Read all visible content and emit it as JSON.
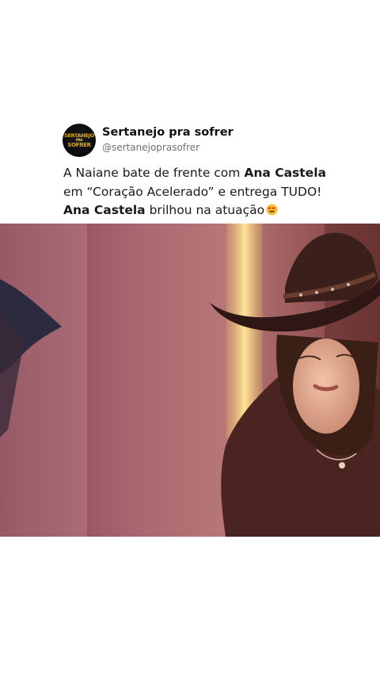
{
  "account": {
    "display_name": "Sertanejo pra sofrer",
    "handle": "@sertanejoprasofrer",
    "avatar_logo": {
      "line1": "SERTANEJO",
      "line2": "PRA",
      "line3": "SOFRER"
    }
  },
  "caption": {
    "line1_prefix": "A Naiane bate de frente com ",
    "line1_bold": "Ana Castela",
    "line2": "em “Coração Acelerado” e entrega TUDO!",
    "line3_bold": "Ana Castela",
    "line3_rest": " brilhou na atuação",
    "emoji": "heart-eyes-emoji-icon"
  },
  "video": {
    "description_icon": "video-frame"
  }
}
